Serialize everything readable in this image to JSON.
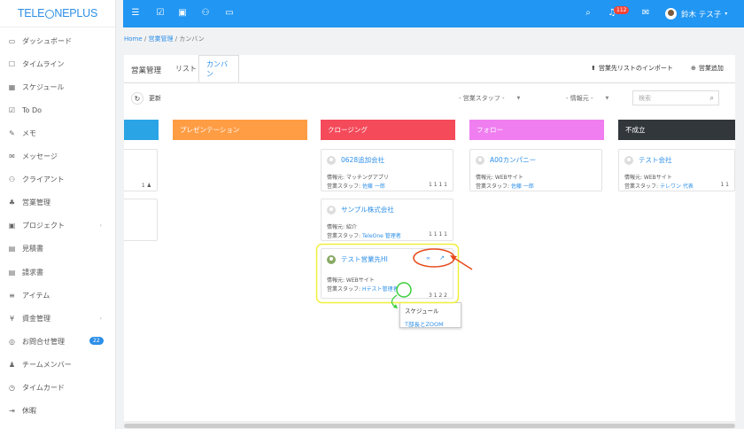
{
  "app": {
    "logo": "TELEONEPLUS"
  },
  "sidebar": {
    "items": [
      {
        "icon": "monitor-icon",
        "label": "ダッシュボード"
      },
      {
        "icon": "square-icon",
        "label": "タイムライン"
      },
      {
        "icon": "calendar-icon",
        "label": "スケジュール"
      },
      {
        "icon": "checkbox-icon",
        "label": "To Do"
      },
      {
        "icon": "edit-icon",
        "label": "メモ"
      },
      {
        "icon": "mail-icon",
        "label": "メッセージ"
      },
      {
        "icon": "users-icon",
        "label": "クライアント"
      },
      {
        "icon": "handshake-icon",
        "label": "営業管理"
      },
      {
        "icon": "briefcase-icon",
        "label": "プロジェクト"
      },
      {
        "icon": "file-icon",
        "label": "見積書"
      },
      {
        "icon": "file-icon",
        "label": "請求書"
      },
      {
        "icon": "list-icon",
        "label": "アイテム"
      },
      {
        "icon": "yen-icon",
        "label": "資金管理"
      },
      {
        "icon": "lifebuoy-icon",
        "label": "お問合せ管理",
        "badge": "22"
      },
      {
        "icon": "user-icon",
        "label": "チームメンバー"
      },
      {
        "icon": "clock-icon",
        "label": "タイムカード"
      },
      {
        "icon": "logout-icon",
        "label": "休暇"
      }
    ]
  },
  "topbar": {
    "notif_count": "112",
    "user_name": "鈴木 テス子"
  },
  "breadcrumb": {
    "home": "Home",
    "section": "営業管理",
    "current": "カンバン"
  },
  "panel": {
    "title": "営業管理",
    "tabs": [
      "リスト",
      "カンバン"
    ],
    "import_label": "営業先リストのインポート",
    "add_label": "営業追加",
    "refresh_label": "更新",
    "staff_select": "- 営業スタッフ -",
    "source_select": "- 情報元 -",
    "search_placeholder": "検索"
  },
  "columns": [
    {
      "title": "",
      "color": "#2ba4e6"
    },
    {
      "title": "プレゼンテーション",
      "color": "#ff9d45"
    },
    {
      "title": "クロージング",
      "color": "#f44a5a"
    },
    {
      "title": "フォロー",
      "color": "#f07ef0"
    },
    {
      "title": "不成立",
      "color": "#32373c"
    }
  ],
  "cards": {
    "c0a": {
      "count": "1"
    },
    "c2a": {
      "title": "0628追加会社",
      "source": "情報元: マッチングアプリ",
      "staff_label": "営業スタッフ:",
      "staff": "佐藤 一郎",
      "counts": "1 1 1 1"
    },
    "c2b": {
      "title": "サンプル株式会社",
      "source": "情報元: 紹介",
      "staff_label": "営業スタッフ:",
      "staff": "TeleOne 管理者",
      "counts": "1 1 1 1"
    },
    "c2c": {
      "title": "テスト営業先HI",
      "source": "情報元: WEBサイト",
      "staff_label": "営業スタッフ:",
      "staff": "Hテスト管理者",
      "counts": "3 1 2 2"
    },
    "c3a": {
      "title": "A00カンパニー",
      "source": "情報元: WEBサイト",
      "staff_label": "営業スタッフ:",
      "staff": "佐藤 一郎"
    },
    "c4a": {
      "title": "テスト会社",
      "source": "情報元: WEBサイト",
      "staff_label": "営業スタッフ:",
      "staff": "テレワン 代表",
      "counts": "1 1"
    }
  },
  "tooltip": {
    "label": "スケジュール",
    "item": "T部長とZOOM"
  },
  "colors": {
    "accent": "#2196f3",
    "link": "#2d8fe8"
  }
}
